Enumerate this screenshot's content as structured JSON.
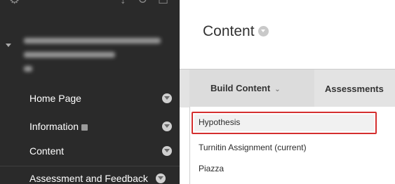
{
  "sidebar": {
    "items": [
      {
        "label": "Home Page",
        "has_inline_icon": false
      },
      {
        "label": "Information",
        "has_inline_icon": true
      },
      {
        "label": "Content",
        "has_inline_icon": false
      },
      {
        "label": "Assessment and Feedback",
        "has_inline_icon": false
      }
    ]
  },
  "main": {
    "page_title": "Content",
    "action_bar": {
      "build_content": "Build Content",
      "assessments": "Assessments"
    },
    "dropdown": {
      "items": [
        "Hypothesis",
        "Turnitin Assignment (current)",
        "Piazza"
      ],
      "highlighted": "Hypothesis",
      "highlight_color": "#d42f2f"
    }
  },
  "colors": {
    "sidebar_bg": "#2a2a2a",
    "action_bar_bg": "#e3e3e3"
  }
}
